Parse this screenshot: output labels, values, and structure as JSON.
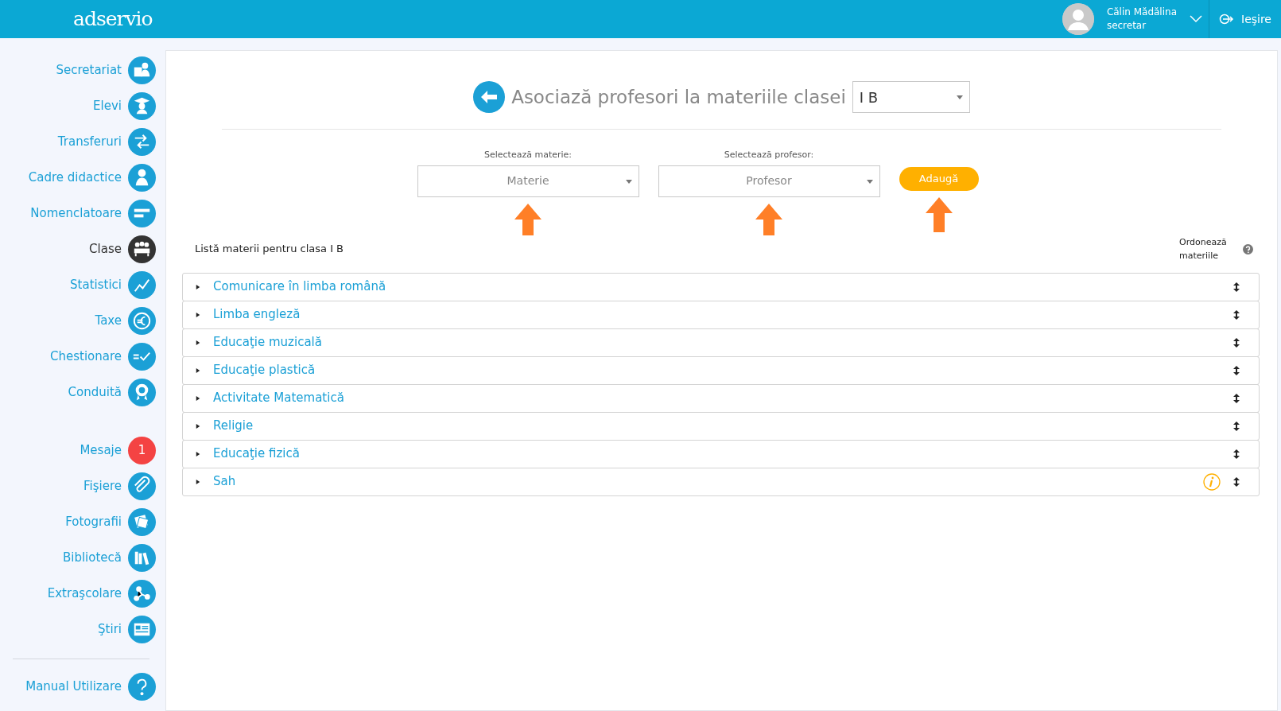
{
  "header": {
    "logo": "adservio",
    "user_name": "Călin Mădălina",
    "user_role": "secretar",
    "logout": "Ieşire"
  },
  "sidebar": {
    "items": [
      {
        "label": "Secretariat",
        "selected": false
      },
      {
        "label": "Elevi",
        "selected": false
      },
      {
        "label": "Transferuri",
        "selected": false
      },
      {
        "label": "Cadre didactice",
        "selected": false
      },
      {
        "label": "Nomenclatoare",
        "selected": false
      },
      {
        "label": "Clase",
        "selected": true
      },
      {
        "label": "Statistici",
        "selected": false
      },
      {
        "label": "Taxe",
        "selected": false
      },
      {
        "label": "Chestionare",
        "selected": false
      },
      {
        "label": "Conduită",
        "selected": false
      }
    ],
    "more_items": [
      {
        "label": "Mesaje",
        "selected": false,
        "count": "1"
      },
      {
        "label": "Fişiere",
        "selected": false
      },
      {
        "label": "Fotografii",
        "selected": false
      },
      {
        "label": "Bibliotecă",
        "selected": false
      },
      {
        "label": "Extraşcolare",
        "selected": false
      },
      {
        "label": "Ştiri",
        "selected": false
      }
    ],
    "footer_item": {
      "label": "Manual Utilizare"
    }
  },
  "page": {
    "title": "Asociază profesori la materiile clasei",
    "class_select": "I B",
    "subject_label": "Selectează materie:",
    "subject_placeholder": "Materie",
    "teacher_label": "Selectează profesor:",
    "teacher_placeholder": "Profesor",
    "add_button": "Adaugă",
    "list_title": "Listă materii pentru clasa I B",
    "order_label": "Ordonează materiile",
    "subjects": [
      {
        "name": "Comunicare în limba română",
        "expanded": false,
        "info": false
      },
      {
        "name": "Limba engleză",
        "expanded": false,
        "info": false
      },
      {
        "name": "Educaţie muzicală",
        "expanded": false,
        "info": false
      },
      {
        "name": "Educaţie plastică",
        "expanded": false,
        "info": false
      },
      {
        "name": "Activitate Matematică",
        "expanded": false,
        "info": false
      },
      {
        "name": "Religie",
        "expanded": false,
        "info": false
      },
      {
        "name": "Educaţie fizică",
        "expanded": false,
        "info": false
      },
      {
        "name": "Sah",
        "expanded": false,
        "info": true
      }
    ]
  }
}
